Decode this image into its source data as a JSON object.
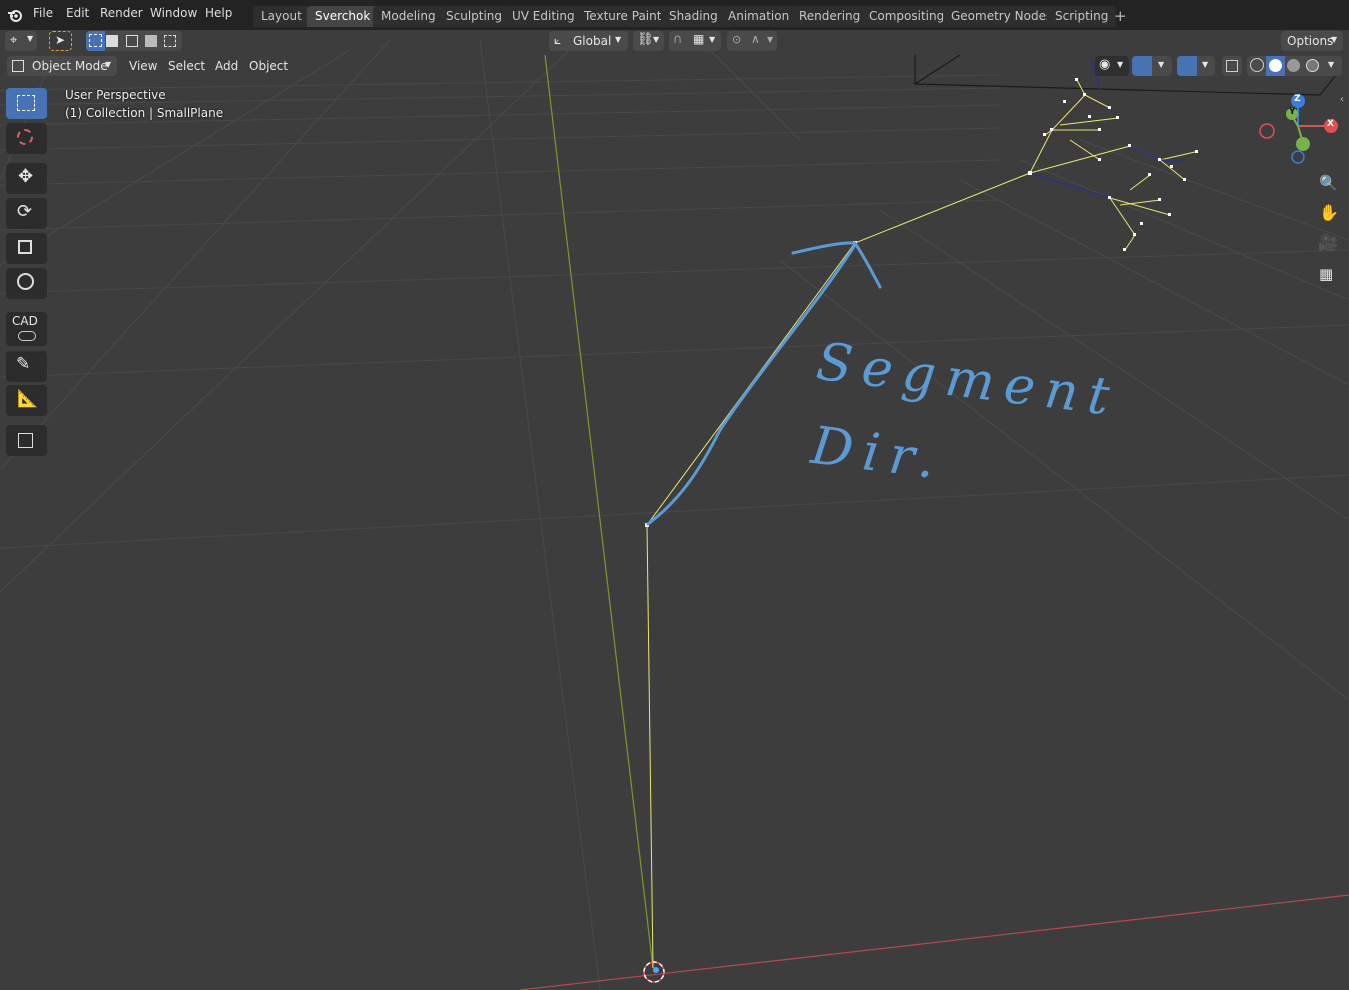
{
  "app": {
    "logo_icon": "blender-logo-icon"
  },
  "menu": [
    "File",
    "Edit",
    "Render",
    "Window",
    "Help"
  ],
  "workspaces": {
    "tabs": [
      "Layout",
      "Sverchok",
      "Modeling",
      "Sculpting",
      "UV Editing",
      "Texture Paint",
      "Shading",
      "Animation",
      "Rendering",
      "Compositing",
      "Geometry Nodes",
      "Scripting"
    ],
    "active": "Sverchok",
    "add_icon": "plus-icon"
  },
  "tool_header": {
    "transform_orientation": "Global",
    "options_label": "Options",
    "icons": [
      "editor-type-icon",
      "select-tool-icon",
      "select-new-icon",
      "select-extend-icon",
      "select-subtract-icon",
      "select-invert-icon",
      "select-intersect-icon",
      "orientation-icon",
      "pivot-icon",
      "snap-icon",
      "snap-increment-icon",
      "proportional-edit-icon",
      "falloff-icon"
    ]
  },
  "view_header": {
    "mode": "Object Mode",
    "menus": [
      "View",
      "Select",
      "Add",
      "Object"
    ]
  },
  "viewport": {
    "perspective_label": "User Perspective",
    "collection_label": "(1) Collection | SmallPlane",
    "annotation_lines": [
      "Segment",
      "Dir."
    ],
    "colors": {
      "background": "#3d3d3d",
      "grid": "#4a4a4a",
      "x_axis": "#b54a4f",
      "y_axis": "#7a9a2a",
      "edges": "#e8e870",
      "annotation": "#5b9bd5",
      "selected_edges": "#2a2f8a"
    }
  },
  "gizmo": {
    "axes": [
      "Z",
      "Y",
      "X"
    ]
  },
  "toolbar_tools": [
    "select-box-icon",
    "cursor-icon",
    "move-icon",
    "rotate-icon",
    "scale-icon",
    "transform-icon",
    "cad-icon",
    "annotate-icon",
    "measure-icon",
    "add-cube-icon"
  ],
  "cad_label": "CAD",
  "nav_tools": [
    "zoom-icon",
    "hand-pan-icon",
    "camera-icon",
    "perspective-grid-icon"
  ]
}
